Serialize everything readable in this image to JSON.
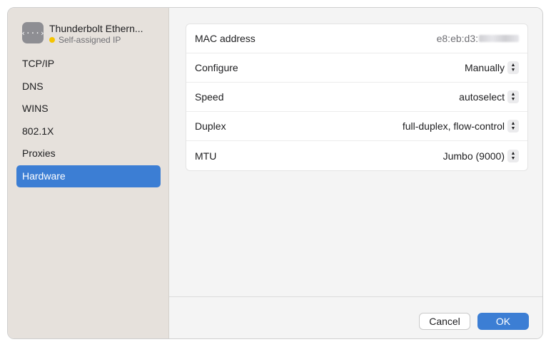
{
  "sidebar": {
    "service": {
      "icon": "ethernet-dots-icon",
      "icon_glyph": "‹···›",
      "name": "Thunderbolt Ethern...",
      "status": "Self-assigned IP",
      "status_color": "#f5c400"
    },
    "items": [
      {
        "label": "TCP/IP"
      },
      {
        "label": "DNS"
      },
      {
        "label": "WINS"
      },
      {
        "label": "802.1X"
      },
      {
        "label": "Proxies"
      },
      {
        "label": "Hardware",
        "selected": true
      }
    ]
  },
  "hardware": {
    "rows": [
      {
        "label": "MAC address",
        "value": "e8:eb:d3:",
        "redacted": true
      },
      {
        "label": "Configure",
        "value": "Manually"
      },
      {
        "label": "Speed",
        "value": "autoselect"
      },
      {
        "label": "Duplex",
        "value": "full-duplex, flow-control"
      },
      {
        "label": "MTU",
        "value": "Jumbo (9000)"
      }
    ]
  },
  "footer": {
    "cancel_label": "Cancel",
    "ok_label": "OK"
  },
  "colors": {
    "accent": "#3c7ed4",
    "sidebar_bg": "#e6e1dc"
  }
}
